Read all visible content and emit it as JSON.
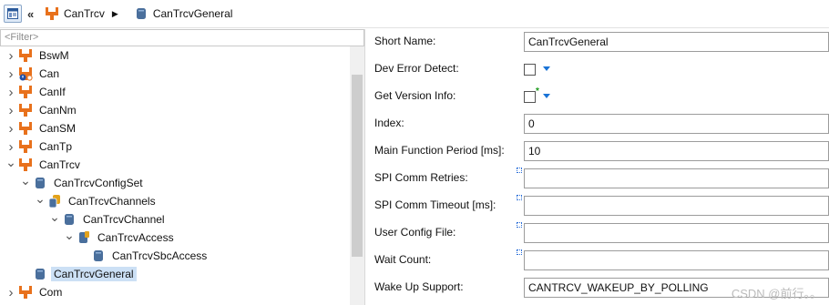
{
  "breadcrumb": {
    "items": [
      {
        "label": "CanTrcv"
      },
      {
        "label": "CanTrcvGeneral"
      }
    ]
  },
  "filter": {
    "placeholder": "<Filter>"
  },
  "tree": [
    {
      "label": "BswM",
      "level": 0,
      "twisty": "collapsed",
      "icon": "module-icon"
    },
    {
      "label": "Can",
      "level": 0,
      "twisty": "collapsed",
      "icon": "module-warning-icon"
    },
    {
      "label": "CanIf",
      "level": 0,
      "twisty": "collapsed",
      "icon": "module-icon"
    },
    {
      "label": "CanNm",
      "level": 0,
      "twisty": "collapsed",
      "icon": "module-icon"
    },
    {
      "label": "CanSM",
      "level": 0,
      "twisty": "collapsed",
      "icon": "module-icon"
    },
    {
      "label": "CanTp",
      "level": 0,
      "twisty": "collapsed",
      "icon": "module-icon"
    },
    {
      "label": "CanTrcv",
      "level": 0,
      "twisty": "expanded",
      "icon": "module-icon"
    },
    {
      "label": "CanTrcvConfigSet",
      "level": 1,
      "twisty": "expanded",
      "icon": "container-icon"
    },
    {
      "label": "CanTrcvChannels",
      "level": 2,
      "twisty": "expanded",
      "icon": "container-list-icon"
    },
    {
      "label": "CanTrcvChannel",
      "level": 3,
      "twisty": "expanded",
      "icon": "container-icon"
    },
    {
      "label": "CanTrcvAccess",
      "level": 4,
      "twisty": "expanded",
      "icon": "choice-container-icon"
    },
    {
      "label": "CanTrcvSbcAccess",
      "level": 5,
      "twisty": "none",
      "icon": "container-icon"
    },
    {
      "label": "CanTrcvGeneral",
      "level": 1,
      "twisty": "none",
      "icon": "container-icon",
      "selected": true
    },
    {
      "label": "Com",
      "level": 0,
      "twisty": "collapsed",
      "icon": "module-icon"
    }
  ],
  "properties": [
    {
      "label": "Short Name:",
      "type": "text",
      "value": "CanTrcvGeneral"
    },
    {
      "label": "Dev Error Detect:",
      "type": "check",
      "checked": false
    },
    {
      "label": "Get Version Info:",
      "type": "check",
      "checked": false,
      "modified": true
    },
    {
      "label": "Index:",
      "type": "text",
      "value": "0"
    },
    {
      "label": "Main Function Period [ms]:",
      "type": "text",
      "value": "10"
    },
    {
      "label": "SPI Comm Retries:",
      "type": "text",
      "value": "",
      "multi": true
    },
    {
      "label": "SPI Comm Timeout [ms]:",
      "type": "text",
      "value": "",
      "multi": true
    },
    {
      "label": "User Config File:",
      "type": "text",
      "value": "",
      "multi": true
    },
    {
      "label": "Wait Count:",
      "type": "text",
      "value": "",
      "multi": true
    },
    {
      "label": "Wake Up Support:",
      "type": "text",
      "value": "CANTRCV_WAKEUP_BY_POLLING"
    }
  ],
  "watermark": "CSDN @前行。。",
  "colors": {
    "accent": "#1a73d6",
    "module": "#e8711c",
    "container": "#4a6f9c",
    "selection": "#cce0f5"
  }
}
